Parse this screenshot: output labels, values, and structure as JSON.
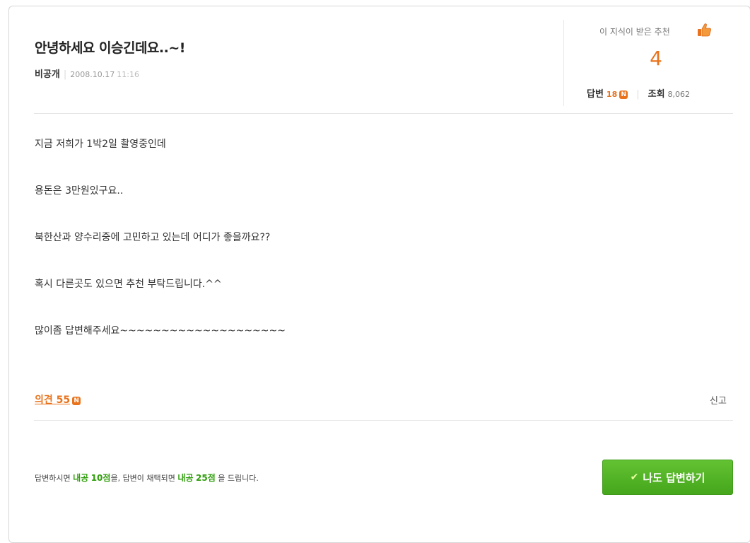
{
  "question": {
    "title": "안녕하세요 이승긴데요..~!",
    "author": "비공개",
    "date": "2008.10.17",
    "time": "11:16"
  },
  "recommend": {
    "label": "이 지식이 받은 추천",
    "count": "4"
  },
  "stats": {
    "answers_label": "답변",
    "answers_count": "18",
    "views_label": "조회",
    "views_count": "8,062",
    "new_badge": "N"
  },
  "body": {
    "lines": [
      "지금 저희가 1박2일 촬영중인데",
      "용돈은 3만원있구요..",
      "북한산과 양수리중에 고민하고 있는데 어디가 좋을까요??",
      "혹시 다른곳도 있으면 추천 부탁드립니다.^^",
      "많이좀 답변해주세요~~~~~~~~~~~~~~~~~~~~"
    ]
  },
  "actions": {
    "opinion_label": "의견",
    "opinion_count": "55",
    "report_label": "신고"
  },
  "footer": {
    "text1": "답변하시면",
    "brand1": "내공",
    "points1": "10점",
    "text2": "을, 답변이 채택되면",
    "brand2": "내공",
    "points2": "25점",
    "text3": "을 드립니다.",
    "answer_button": "나도 답변하기"
  },
  "colors": {
    "accent_orange": "#e8731c",
    "accent_green": "#46a61c"
  },
  "icons": {
    "thumb": "thumbs-up-icon",
    "check": "check-icon"
  }
}
